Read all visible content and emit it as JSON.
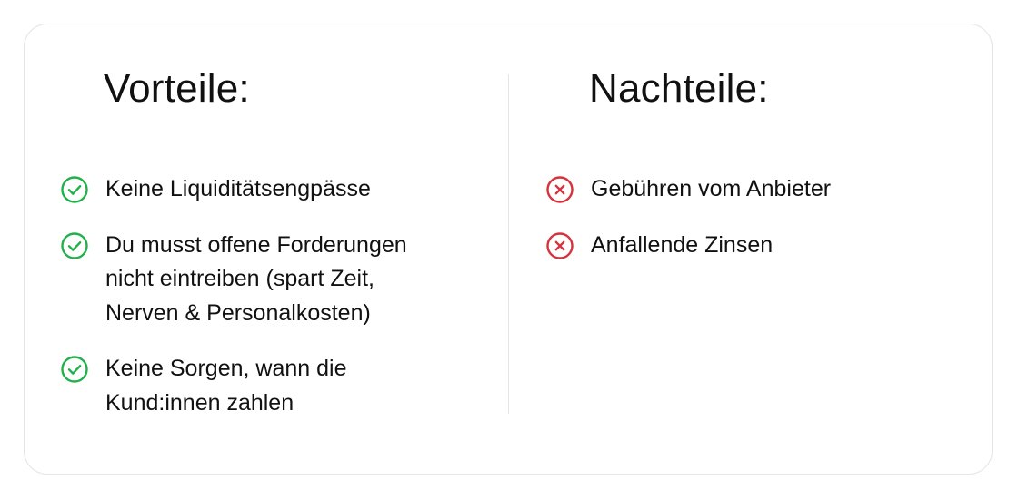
{
  "colors": {
    "positive": "#22b04b",
    "negative": "#d6323c"
  },
  "pros": {
    "title": "Vorteile:",
    "items": [
      {
        "icon": "check-circle-icon",
        "lines": [
          "Keine Liquiditätsengpässe"
        ]
      },
      {
        "icon": "check-circle-icon",
        "lines": [
          "Du musst offene Forderungen",
          "nicht eintreiben (spart Zeit,",
          "Nerven & Personalkosten)"
        ]
      },
      {
        "icon": "check-circle-icon",
        "lines": [
          "Keine Sorgen, wann die",
          "Kund:innen zahlen"
        ]
      }
    ]
  },
  "cons": {
    "title": "Nachteile:",
    "items": [
      {
        "icon": "x-circle-icon",
        "lines": [
          "Gebühren vom Anbieter"
        ]
      },
      {
        "icon": "x-circle-icon",
        "lines": [
          "Anfallende Zinsen"
        ]
      }
    ]
  }
}
